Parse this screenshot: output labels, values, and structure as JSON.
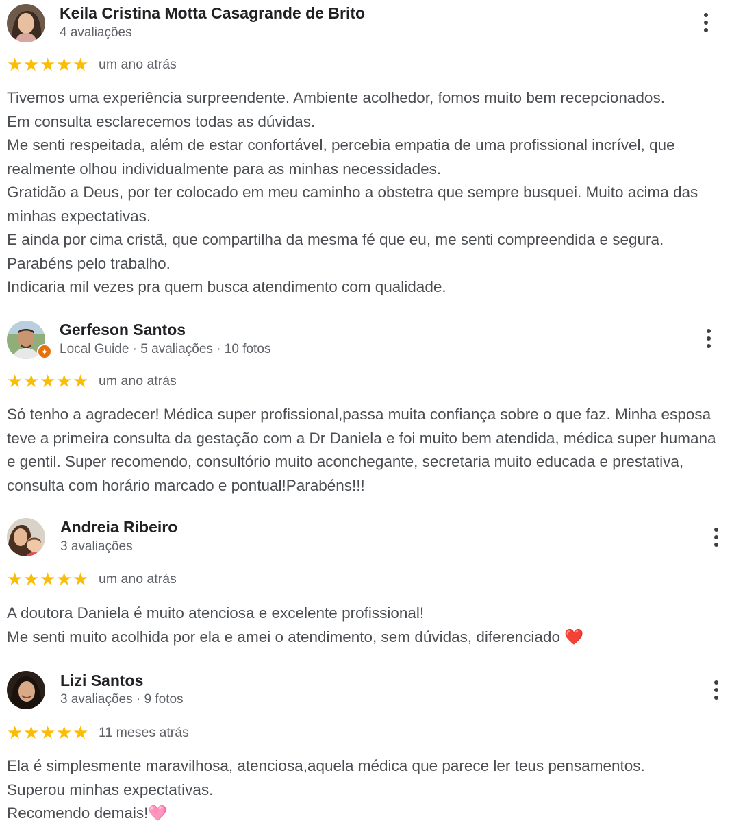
{
  "reviews": [
    {
      "name": "Keila Cristina Motta Casagrande de Brito",
      "meta": "4 avaliações",
      "local_guide": false,
      "rating": 5,
      "date": "um ano atrás",
      "text": "Tivemos uma experiência surpreendente. Ambiente acolhedor, fomos muito bem recepcionados.\nEm consulta esclarecemos todas as dúvidas.\nMe senti respeitada, além de estar confortável, percebia empatia de uma profissional incrível, que realmente olhou individualmente para as minhas necessidades.\nGratidão a Deus, por ter colocado em meu caminho a obstetra que sempre busquei. Muito acima das minhas expectativas.\nE ainda por cima cristã, que compartilha da mesma fé que eu, me senti compreendida e segura.\nParabéns pelo trabalho.\nIndicaria mil vezes pra quem busca atendimento com qualidade."
    },
    {
      "name": "Gerfeson Santos",
      "meta": "Local Guide · 5 avaliações · 10 fotos",
      "local_guide": true,
      "rating": 5,
      "date": "um ano atrás",
      "text": "Só tenho a agradecer! Médica super profissional,passa muita confiança sobre o que faz. Minha esposa teve a primeira consulta da gestação com a Dr Daniela e foi muito bem atendida, médica super humana e gentil. Super recomendo, consultório muito aconchegante, secretaria muito educada e prestativa, consulta com horário marcado e pontual!Parabéns!!!"
    },
    {
      "name": "Andreia Ribeiro",
      "meta": "3 avaliações",
      "local_guide": false,
      "rating": 5,
      "date": "um ano atrás",
      "text": "A doutora Daniela é muito atenciosa e excelente profissional!\nMe senti muito acolhida por ela e amei o atendimento, sem dúvidas, diferenciado ❤️"
    },
    {
      "name": "Lizi Santos",
      "meta": "3 avaliações · 9 fotos",
      "local_guide": false,
      "rating": 5,
      "date": "11 meses atrás",
      "text": "Ela é simplesmente maravilhosa, atenciosa,aquela médica que parece ler teus pensamentos.\nSuperou minhas expectativas.\nRecomendo demais!🩷"
    }
  ],
  "icons": {
    "star": "★",
    "menu": "more-vert-icon",
    "local_guide_badge": "local-guide-star-icon"
  },
  "colors": {
    "star": "#fbbc04",
    "name": "#202124",
    "secondary": "#5f6368",
    "body_text": "#4a4d51",
    "local_guide_badge": "#e8710a"
  }
}
